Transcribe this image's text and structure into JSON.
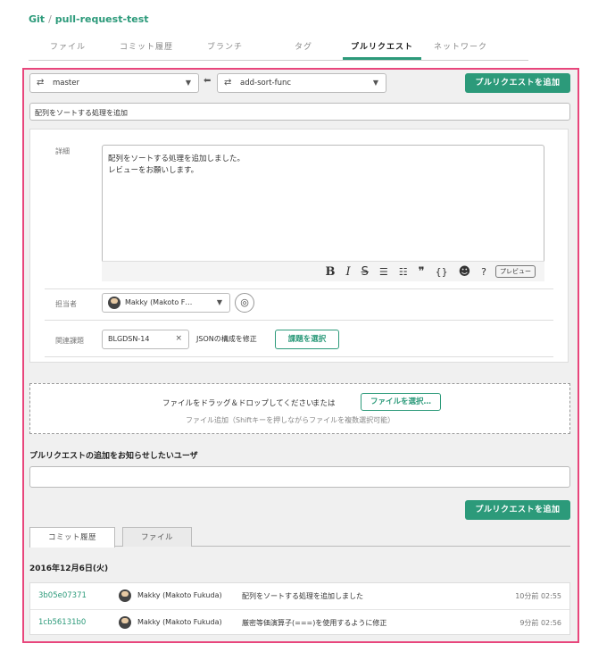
{
  "breadcrumb": {
    "project": "Git",
    "separator": "/",
    "repository": "pull-request-test"
  },
  "tabs": [
    "ファイル",
    "コミット履歴",
    "ブランチ",
    "タグ",
    "プルリクエスト",
    "ネットワーク"
  ],
  "active_tab": "プルリクエスト",
  "branches": {
    "base": "master",
    "compare": "add-sort-func"
  },
  "add_pr_label": "プルリクエストを追加",
  "title_value": "配列をソートする処理を追加",
  "details": {
    "label": "詳細",
    "lines": [
      "配列をソートする処理を追加しました。",
      "レビューをお願いします。"
    ],
    "toolbar": {
      "bold": "B",
      "italic": "I",
      "strike": "S",
      "bullet_list": "☰",
      "numbered_list": "☷",
      "quote": "❞",
      "code": "{}",
      "emoji": "☻",
      "help": "?",
      "preview": "プレビュー"
    }
  },
  "assignee": {
    "label": "担当者",
    "value": "Makky (Makoto F…"
  },
  "related_issue": {
    "label": "関連課題",
    "key": "BLGDSN-14",
    "clear": "×",
    "title": "JSONの構成を修正",
    "select_label": "課題を選択"
  },
  "dropzone": {
    "text": "ファイルをドラッグ＆ドロップしてください",
    "or": "または",
    "button": "ファイルを選択…",
    "sub": "ファイル追加（Shiftキーを押しながらファイルを複数選択可能）"
  },
  "notify_label": "プルリクエストの追加をお知らせしたいユーザ",
  "notify_value": "",
  "subtabs": [
    "コミット履歴",
    "ファイル"
  ],
  "commit_date": "2016年12月6日(火)",
  "commits": [
    {
      "hash": "3b05e07371",
      "author": "Makky (Makoto Fukuda)",
      "message": "配列をソートする処理を追加しました",
      "time": "10分前 02:55"
    },
    {
      "hash": "1cb56131b0",
      "author": "Makky (Makoto Fukuda)",
      "message": "厳密等価演算子(===)を使用するように修正",
      "time": "9分前 02:56"
    }
  ],
  "colors": {
    "accent": "#2c9a7a",
    "highlight_border": "#e8467c",
    "panel_bg": "#f0f0f0"
  },
  "icons": {
    "branch": "⇄",
    "caret": "▼",
    "arrow_left": "⬅",
    "watch": "◎"
  }
}
